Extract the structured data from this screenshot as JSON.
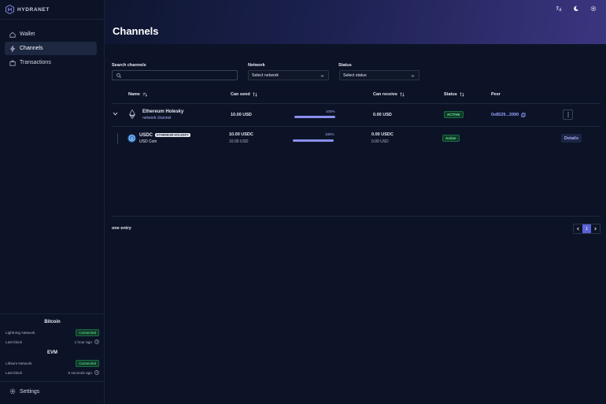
{
  "brand": {
    "name": "HYDRANET"
  },
  "nav": {
    "wallet": "Wallet",
    "channels": "Channels",
    "transactions": "Transactions"
  },
  "sidebar_status": {
    "bitcoin": {
      "title": "Bitcoin",
      "network_label": "Lightning Network",
      "network_status": "Connected",
      "block_label": "Last block",
      "block_value": "1 hour ago"
    },
    "evm": {
      "title": "EVM",
      "network_label": "Lithium Network",
      "network_status": "Connected",
      "block_label": "Last block",
      "block_value": "5 seconds ago"
    },
    "settings": "Settings"
  },
  "page": {
    "title": "Channels"
  },
  "filters": {
    "search_label": "Search channels",
    "search_placeholder": "",
    "network_label": "Network",
    "network_value": "Select network",
    "status_label": "Status",
    "status_value": "Select status"
  },
  "table": {
    "headers": {
      "name": "Name",
      "can_send": "Can send",
      "can_receive": "Can receive",
      "status": "Status",
      "peer": "Peer"
    },
    "group": {
      "name": "Ethereum Holesky",
      "subtitle": "network channel",
      "can_send": "10.00 USD",
      "progress_label": "100%",
      "progress": 1.0,
      "can_receive": "0.00 USD",
      "status": "ACTIVE",
      "peer": "0x8529...3990"
    },
    "row": {
      "name": "USDC",
      "tag": "ETHEREUM HOLESKY",
      "subtitle": "USD Coin",
      "can_send": "10.00 USDC",
      "can_send_sub": "10.00 USD",
      "progress_label": "100%",
      "progress": 1.0,
      "can_receive": "0.00 USDC",
      "can_receive_sub": "0.00 USD",
      "status": "Active",
      "action": "Details"
    }
  },
  "footer": {
    "entries": "one entry",
    "page": "1"
  },
  "colors": {
    "accent": "#8b8ff0",
    "active_green": "#6ee7a0",
    "peer_link": "#8fa2ff"
  }
}
